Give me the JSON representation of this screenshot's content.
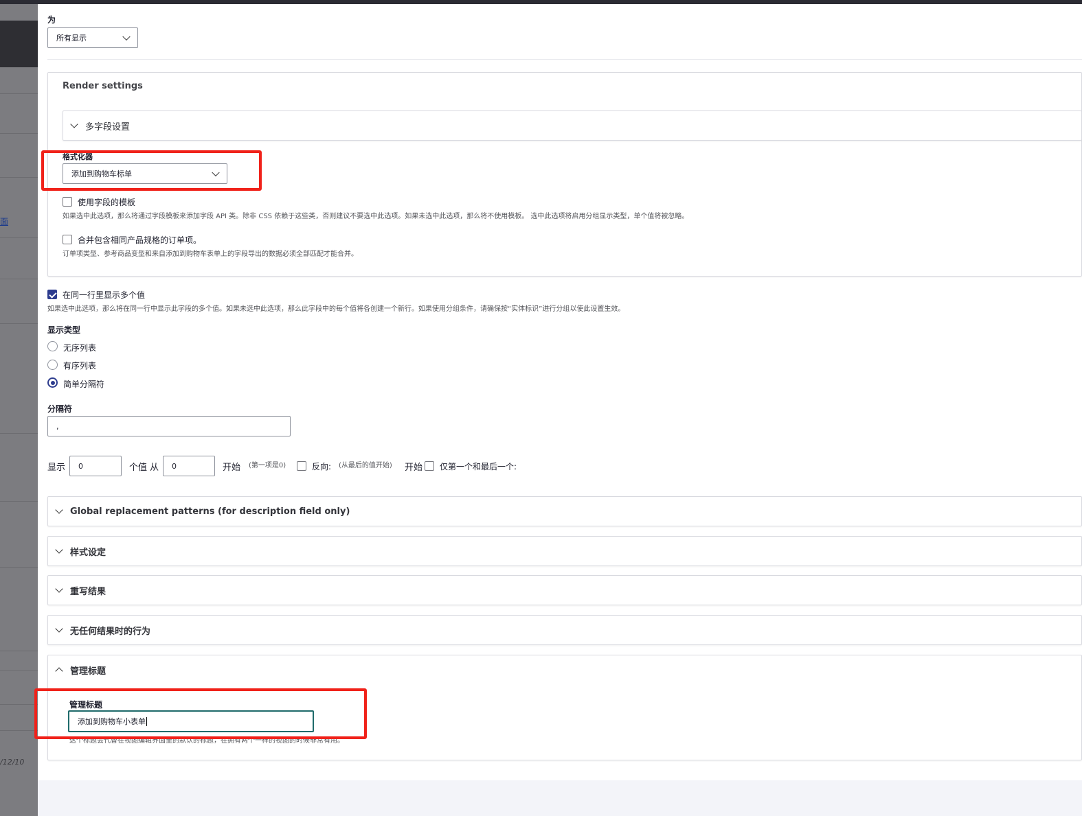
{
  "backdrop": {
    "link_fragment": "面",
    "date_fragment": "/12/10"
  },
  "top": {
    "for_label": "为",
    "for_select": "所有显示"
  },
  "render": {
    "title": "Render settings",
    "multi_field": "多字段设置",
    "formatter_label": "格式化器",
    "formatter_select": "添加到购物车标单",
    "use_template_label": "使用字段的模板",
    "use_template_desc": "如果选中此选项，那么将通过字段模板来添加字段 API 类。除非 CSS 依赖于这些类，否则建议不要选中此选项。如果未选中此选项，那么将不使用模板。 选中此选项将启用分组显示类型，单个值将被忽略。",
    "merge_label": "合并包含相同产品规格的订单项。",
    "merge_desc": "订单项类型、参考商品变型和来自添加到购物车表单上的字段导出的数据必须全部匹配才能合并。"
  },
  "multi": {
    "same_row_label": "在同一行里显示多个值",
    "same_row_desc": "如果选中此选项，那么将在同一行中显示此字段的多个值。如果未选中此选项，那么此字段中的每个值将各创建一个新行。如果使用分组条件，请确保按“实体标识”进行分组以使此设置生效。",
    "display_type_label": "显示类型",
    "options": [
      "无序列表",
      "有序列表",
      "简单分隔符"
    ],
    "selected_option": 2,
    "separator_label": "分隔符",
    "separator_value": ","
  },
  "range": {
    "show": "显示",
    "count_value": "0",
    "values_from": "个值 从",
    "from_value": "0",
    "start": "开始",
    "start_hint": "(第一项是0)",
    "reverse": "反向:",
    "reverse_hint": "(从最后的值开始)",
    "start2": "开始",
    "first_last": "仅第一个和最后一个:"
  },
  "sections": {
    "global": "Global replacement patterns (for description field only)",
    "style": "样式设定",
    "rewrite": "重写结果",
    "no_result": "无任何结果时的行为",
    "admin": "管理标题"
  },
  "admin": {
    "title_label": "管理标题",
    "title_value": "添加到购物车小表单",
    "title_desc": "这个标题会代替在视图编辑界面里的默认的标题，在拥有两个一样的视图的时候非常有用。"
  },
  "colors": {
    "accent": "#2d3c8e",
    "highlight": "#f0221a",
    "focus": "#1f6b6b"
  }
}
